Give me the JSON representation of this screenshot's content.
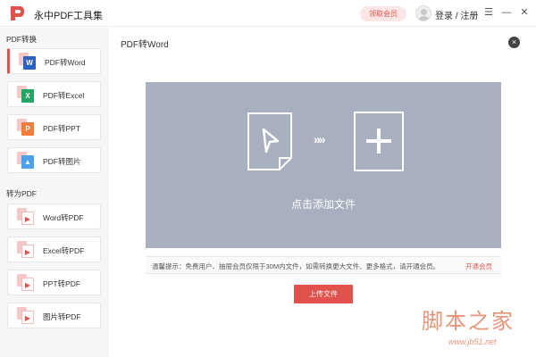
{
  "app": {
    "title": "永中PDF工具集",
    "vip_button": "领取会员",
    "login": "登录 / 注册"
  },
  "window": {
    "menu_glyph": "☰",
    "minimize_glyph": "—",
    "close_glyph": "✕"
  },
  "sidebar": {
    "section_1": "PDF转换",
    "section_2": "转为PDF",
    "items": [
      {
        "label": "PDF转Word",
        "icon": "word-icon",
        "glyph": "W",
        "active": true
      },
      {
        "label": "PDF转Excel",
        "icon": "excel-icon",
        "glyph": "X",
        "active": false
      },
      {
        "label": "PDF转PPT",
        "icon": "ppt-icon",
        "glyph": "P",
        "active": false
      },
      {
        "label": "PDF转图片",
        "icon": "image-icon",
        "glyph": "▲",
        "active": false
      },
      {
        "label": "Word转PDF",
        "icon": "pdf-icon",
        "glyph": "▶",
        "active": false
      },
      {
        "label": "Excel转PDF",
        "icon": "pdf-icon",
        "glyph": "▶",
        "active": false
      },
      {
        "label": "PPT转PDF",
        "icon": "pdf-icon",
        "glyph": "▶",
        "active": false
      },
      {
        "label": "图片转PDF",
        "icon": "pdf-icon",
        "glyph": "▶",
        "active": false
      }
    ]
  },
  "main": {
    "title": "PDF转Word",
    "close_glyph": "×",
    "drop_label": "点击添加文件",
    "arrows": "»»",
    "tip": "温馨提示：免费用户、抽屉会员仅限于30M内文件，如需转换更大文件、更多格式，请开通会员。",
    "tip_link": "开通会员",
    "upload_button": "上传文件"
  },
  "watermark": {
    "big": "脚本之家",
    "small": "www.jb51.net"
  },
  "colors": {
    "accent": "#e0524c",
    "drop_zone": "#a8b0bf",
    "sidebar_bg": "#f5f6f8"
  }
}
